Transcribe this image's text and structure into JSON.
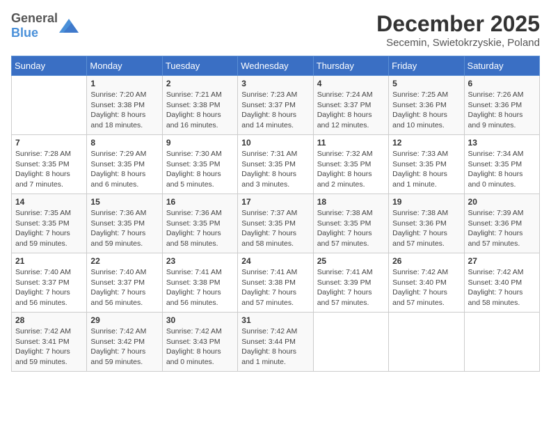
{
  "header": {
    "logo_general": "General",
    "logo_blue": "Blue",
    "title": "December 2025",
    "subtitle": "Secemin, Swietokrzyskie, Poland"
  },
  "weekdays": [
    "Sunday",
    "Monday",
    "Tuesday",
    "Wednesday",
    "Thursday",
    "Friday",
    "Saturday"
  ],
  "weeks": [
    [
      {
        "day": "",
        "info": ""
      },
      {
        "day": "1",
        "info": "Sunrise: 7:20 AM\nSunset: 3:38 PM\nDaylight: 8 hours\nand 18 minutes."
      },
      {
        "day": "2",
        "info": "Sunrise: 7:21 AM\nSunset: 3:38 PM\nDaylight: 8 hours\nand 16 minutes."
      },
      {
        "day": "3",
        "info": "Sunrise: 7:23 AM\nSunset: 3:37 PM\nDaylight: 8 hours\nand 14 minutes."
      },
      {
        "day": "4",
        "info": "Sunrise: 7:24 AM\nSunset: 3:37 PM\nDaylight: 8 hours\nand 12 minutes."
      },
      {
        "day": "5",
        "info": "Sunrise: 7:25 AM\nSunset: 3:36 PM\nDaylight: 8 hours\nand 10 minutes."
      },
      {
        "day": "6",
        "info": "Sunrise: 7:26 AM\nSunset: 3:36 PM\nDaylight: 8 hours\nand 9 minutes."
      }
    ],
    [
      {
        "day": "7",
        "info": "Sunrise: 7:28 AM\nSunset: 3:35 PM\nDaylight: 8 hours\nand 7 minutes."
      },
      {
        "day": "8",
        "info": "Sunrise: 7:29 AM\nSunset: 3:35 PM\nDaylight: 8 hours\nand 6 minutes."
      },
      {
        "day": "9",
        "info": "Sunrise: 7:30 AM\nSunset: 3:35 PM\nDaylight: 8 hours\nand 5 minutes."
      },
      {
        "day": "10",
        "info": "Sunrise: 7:31 AM\nSunset: 3:35 PM\nDaylight: 8 hours\nand 3 minutes."
      },
      {
        "day": "11",
        "info": "Sunrise: 7:32 AM\nSunset: 3:35 PM\nDaylight: 8 hours\nand 2 minutes."
      },
      {
        "day": "12",
        "info": "Sunrise: 7:33 AM\nSunset: 3:35 PM\nDaylight: 8 hours\nand 1 minute."
      },
      {
        "day": "13",
        "info": "Sunrise: 7:34 AM\nSunset: 3:35 PM\nDaylight: 8 hours\nand 0 minutes."
      }
    ],
    [
      {
        "day": "14",
        "info": "Sunrise: 7:35 AM\nSunset: 3:35 PM\nDaylight: 7 hours\nand 59 minutes."
      },
      {
        "day": "15",
        "info": "Sunrise: 7:36 AM\nSunset: 3:35 PM\nDaylight: 7 hours\nand 59 minutes."
      },
      {
        "day": "16",
        "info": "Sunrise: 7:36 AM\nSunset: 3:35 PM\nDaylight: 7 hours\nand 58 minutes."
      },
      {
        "day": "17",
        "info": "Sunrise: 7:37 AM\nSunset: 3:35 PM\nDaylight: 7 hours\nand 58 minutes."
      },
      {
        "day": "18",
        "info": "Sunrise: 7:38 AM\nSunset: 3:35 PM\nDaylight: 7 hours\nand 57 minutes."
      },
      {
        "day": "19",
        "info": "Sunrise: 7:38 AM\nSunset: 3:36 PM\nDaylight: 7 hours\nand 57 minutes."
      },
      {
        "day": "20",
        "info": "Sunrise: 7:39 AM\nSunset: 3:36 PM\nDaylight: 7 hours\nand 57 minutes."
      }
    ],
    [
      {
        "day": "21",
        "info": "Sunrise: 7:40 AM\nSunset: 3:37 PM\nDaylight: 7 hours\nand 56 minutes."
      },
      {
        "day": "22",
        "info": "Sunrise: 7:40 AM\nSunset: 3:37 PM\nDaylight: 7 hours\nand 56 minutes."
      },
      {
        "day": "23",
        "info": "Sunrise: 7:41 AM\nSunset: 3:38 PM\nDaylight: 7 hours\nand 56 minutes."
      },
      {
        "day": "24",
        "info": "Sunrise: 7:41 AM\nSunset: 3:38 PM\nDaylight: 7 hours\nand 57 minutes."
      },
      {
        "day": "25",
        "info": "Sunrise: 7:41 AM\nSunset: 3:39 PM\nDaylight: 7 hours\nand 57 minutes."
      },
      {
        "day": "26",
        "info": "Sunrise: 7:42 AM\nSunset: 3:40 PM\nDaylight: 7 hours\nand 57 minutes."
      },
      {
        "day": "27",
        "info": "Sunrise: 7:42 AM\nSunset: 3:40 PM\nDaylight: 7 hours\nand 58 minutes."
      }
    ],
    [
      {
        "day": "28",
        "info": "Sunrise: 7:42 AM\nSunset: 3:41 PM\nDaylight: 7 hours\nand 59 minutes."
      },
      {
        "day": "29",
        "info": "Sunrise: 7:42 AM\nSunset: 3:42 PM\nDaylight: 7 hours\nand 59 minutes."
      },
      {
        "day": "30",
        "info": "Sunrise: 7:42 AM\nSunset: 3:43 PM\nDaylight: 8 hours\nand 0 minutes."
      },
      {
        "day": "31",
        "info": "Sunrise: 7:42 AM\nSunset: 3:44 PM\nDaylight: 8 hours\nand 1 minute."
      },
      {
        "day": "",
        "info": ""
      },
      {
        "day": "",
        "info": ""
      },
      {
        "day": "",
        "info": ""
      }
    ]
  ]
}
